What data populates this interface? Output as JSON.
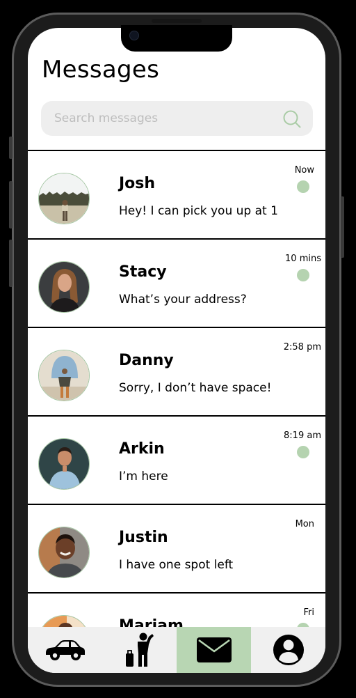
{
  "header": {
    "title": "Messages"
  },
  "search": {
    "placeholder": "Search messages"
  },
  "conversations": [
    {
      "name": "Josh",
      "preview": "Hey! I can pick you up at 1",
      "time": "Now",
      "unread": true
    },
    {
      "name": "Stacy",
      "preview": "What’s your address?",
      "time": "10 mins",
      "unread": true
    },
    {
      "name": "Danny",
      "preview": "Sorry, I don’t have space!",
      "time": "2:58 pm",
      "unread": false
    },
    {
      "name": "Arkin",
      "preview": "I’m here",
      "time": "8:19 am",
      "unread": true
    },
    {
      "name": "Justin",
      "preview": "I have one spot left",
      "time": "Mon",
      "unread": false
    },
    {
      "name": "Mariam",
      "preview": "",
      "time": "Fri",
      "unread": true
    }
  ],
  "tabs": [
    {
      "icon": "car-icon",
      "active": false
    },
    {
      "icon": "traveler-icon",
      "active": false
    },
    {
      "icon": "envelope-icon",
      "active": true
    },
    {
      "icon": "profile-icon",
      "active": false
    }
  ],
  "colors": {
    "accent": "#b8d6b3",
    "unread_dot": "#b5d3b0",
    "avatar_ring": "#a5c6a3",
    "search_bg": "#eeeeee"
  }
}
